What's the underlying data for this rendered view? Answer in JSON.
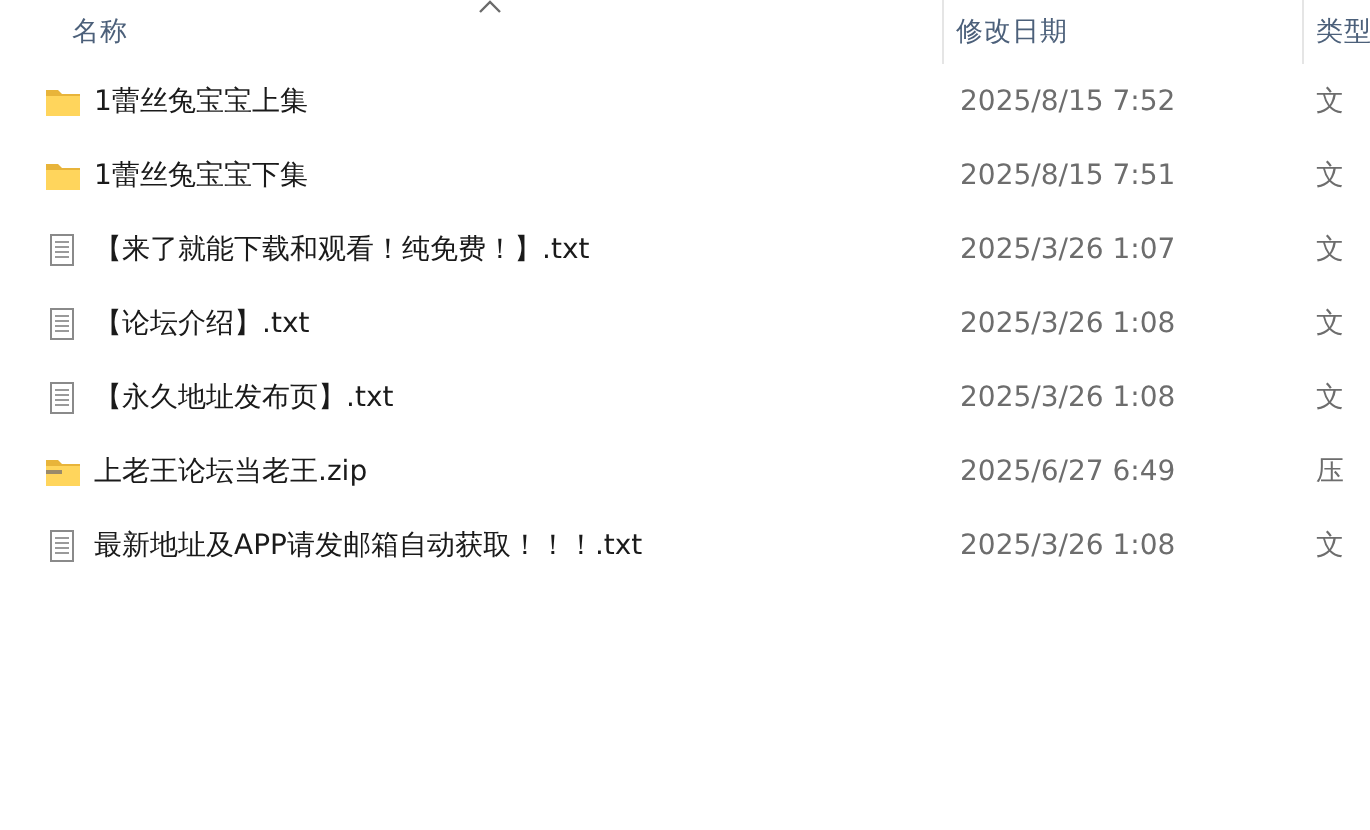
{
  "columns": [
    {
      "label": "名称",
      "sorted": true
    },
    {
      "label": "修改日期",
      "sorted": false
    },
    {
      "label": "类型",
      "sorted": false
    }
  ],
  "files": [
    {
      "kind": "folder",
      "name": "1蕾丝兔宝宝上集",
      "modified": "2025/8/15 7:52",
      "type": "文"
    },
    {
      "kind": "folder",
      "name": "1蕾丝兔宝宝下集",
      "modified": "2025/8/15 7:51",
      "type": "文"
    },
    {
      "kind": "text",
      "name": "【来了就能下载和观看！纯免费！】.txt",
      "modified": "2025/3/26 1:07",
      "type": "文"
    },
    {
      "kind": "text",
      "name": "【论坛介绍】.txt",
      "modified": "2025/3/26 1:08",
      "type": "文"
    },
    {
      "kind": "text",
      "name": "【永久地址发布页】.txt",
      "modified": "2025/3/26 1:08",
      "type": "文"
    },
    {
      "kind": "zip",
      "name": "上老王论坛当老王.zip",
      "modified": "2025/6/27 6:49",
      "type": "压"
    },
    {
      "kind": "text",
      "name": "最新地址及APP请发邮箱自动获取！！！.txt",
      "modified": "2025/3/26 1:08",
      "type": "文"
    }
  ]
}
